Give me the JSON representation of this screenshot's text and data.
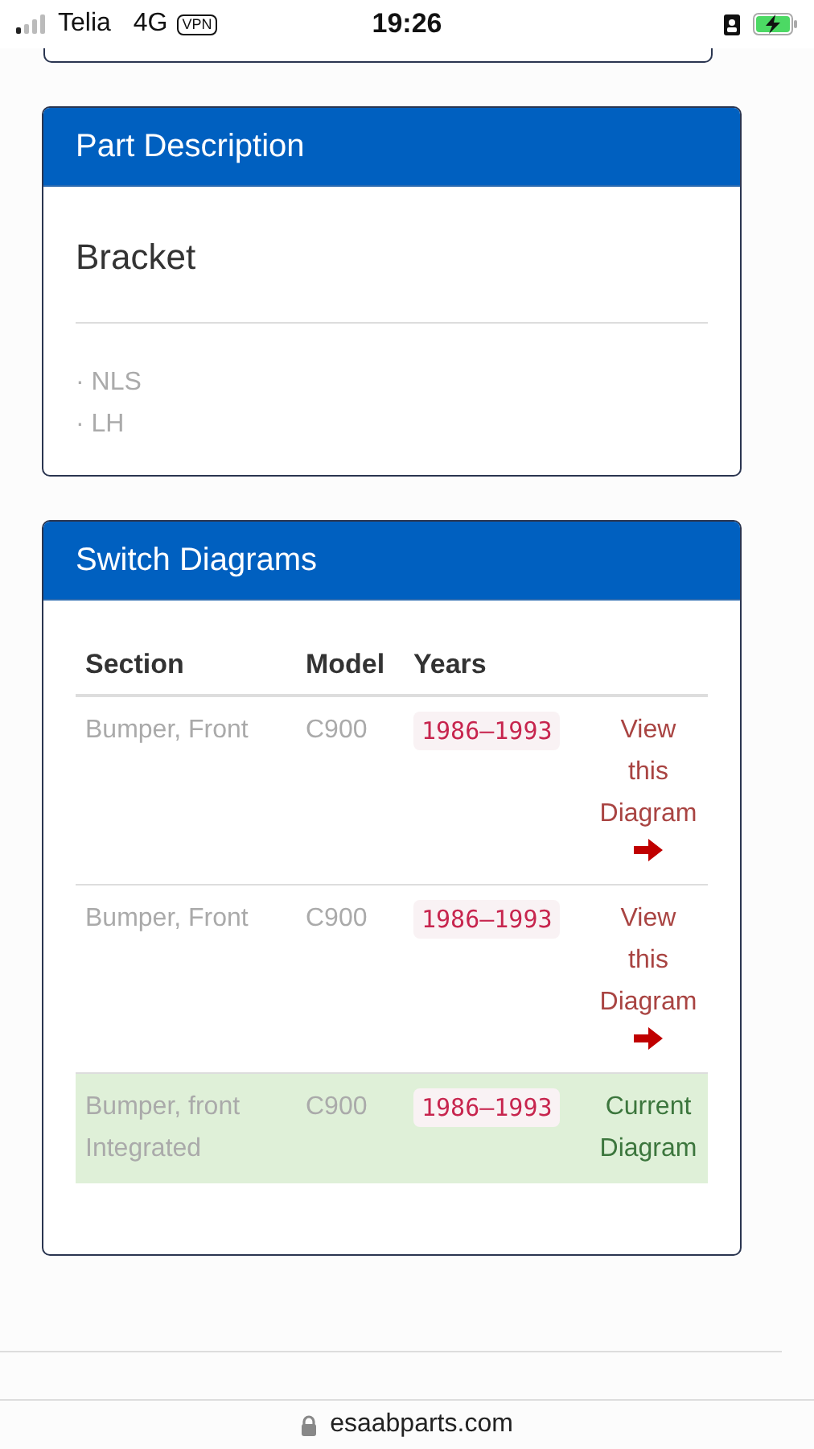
{
  "status_bar": {
    "carrier": "Telia",
    "network": "4G",
    "vpn": "VPN",
    "time": "19:26"
  },
  "part_description": {
    "title": "Part Description",
    "name": "Bracket",
    "notes": [
      "· NLS",
      "· LH"
    ]
  },
  "switch_diagrams": {
    "title": "Switch Diagrams",
    "columns": [
      "Section",
      "Model",
      "Years"
    ],
    "rows": [
      {
        "section": "Bumper, Front",
        "model": "C900",
        "years": "1986–1993",
        "action": "View this Diagram",
        "current": false
      },
      {
        "section": "Bumper, Front",
        "model": "C900",
        "years": "1986–1993",
        "action": "View this Diagram",
        "current": false
      },
      {
        "section": "Bumper, front Integrated",
        "model": "C900",
        "years": "1986–1993",
        "action": "Current Diagram",
        "current": true
      }
    ]
  },
  "address_bar": {
    "url": "esaabparts.com"
  }
}
